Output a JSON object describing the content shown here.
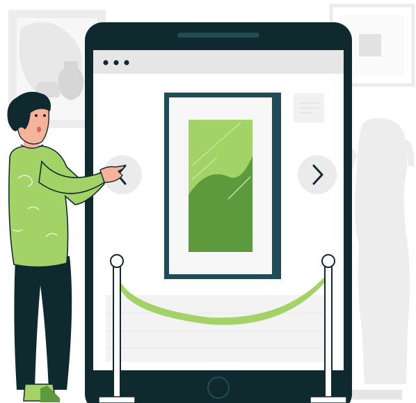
{
  "illustration": {
    "kind": "virtual museum tour",
    "colors": {
      "device_frame": "#0f2a2f",
      "screen": "#ffffff",
      "browser_bar": "#e6e6e6",
      "accent_green": "#a3d366",
      "dark_green": "#5d9a3e",
      "frame_border": "#1e4d55",
      "background_art": "#ebebeb",
      "skin": "#f5b49a",
      "hair": "#0f2a2f"
    },
    "icons": {
      "prev": "chevron-left-icon",
      "next": "chevron-right-icon",
      "window_dots": "more-dots-icon",
      "home": "home-button-icon"
    }
  }
}
